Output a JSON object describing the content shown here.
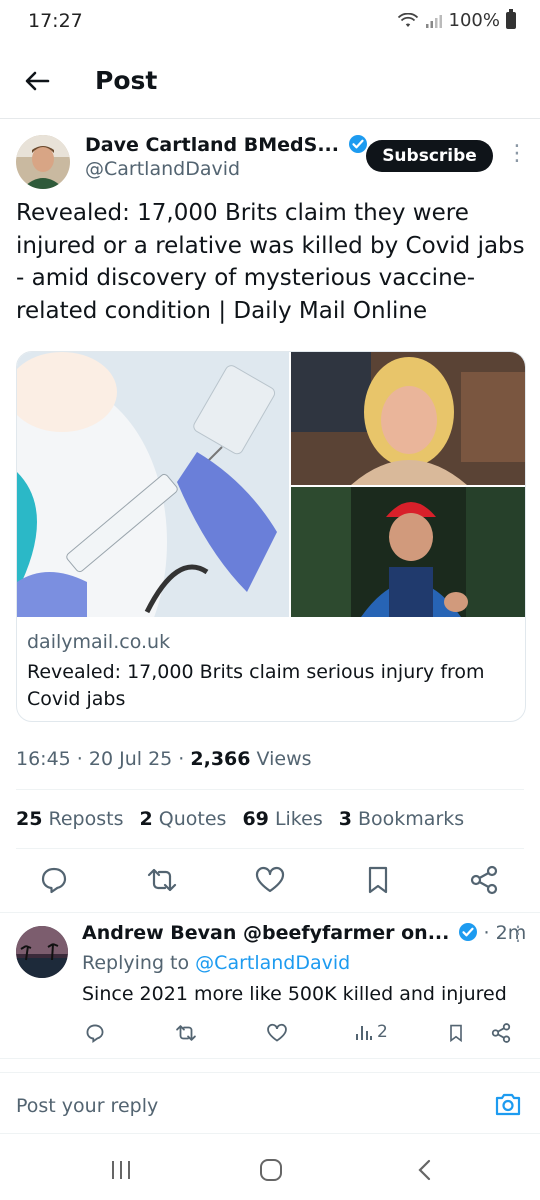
{
  "status_bar": {
    "time": "17:27",
    "battery": "100%"
  },
  "header": {
    "title": "Post"
  },
  "post": {
    "author_name": "Dave Cartland BMedS...",
    "author_handle": "@CartlandDavid",
    "subscribe_label": "Subscribe",
    "text": "Revealed: 17,000 Brits claim they were injured or a relative was killed by Covid jabs - amid discovery of mysterious vaccine-related condition | Daily Mail Online",
    "card": {
      "domain": "dailymail.co.uk",
      "title": "Revealed: 17,000 Brits claim serious injury from Covid jabs"
    },
    "time": "16:45",
    "date": "20 Jul 25",
    "views_count": "2,366",
    "views_label": "Views",
    "stats": {
      "reposts_count": "25",
      "reposts_label": "Reposts",
      "quotes_count": "2",
      "quotes_label": "Quotes",
      "likes_count": "69",
      "likes_label": "Likes",
      "bookmarks_count": "3",
      "bookmarks_label": "Bookmarks"
    }
  },
  "reply": {
    "author": "Andrew Bevan @beefyfarmer on...",
    "time": "2m",
    "replying_prefix": "Replying to",
    "replying_handle": "@CartlandDavid",
    "text": "Since 2021 more like 500K killed and injured",
    "views": "2"
  },
  "composer": {
    "placeholder": "Post your reply"
  },
  "colors": {
    "accent": "#1d9bf0",
    "text": "#0f1419",
    "secondary": "#536471"
  }
}
